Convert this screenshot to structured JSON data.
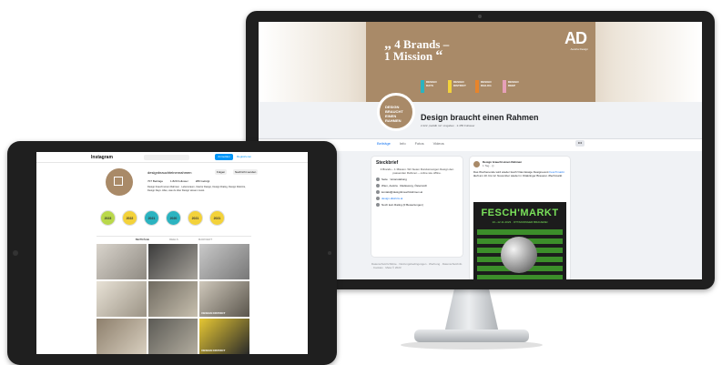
{
  "facebook": {
    "cover": {
      "quote_open": "„",
      "headline_line1": "4 Brands –",
      "headline_line2": "1 Mission",
      "quote_close": "“",
      "brand_logo": "AD",
      "brand_logo_sub": "Austria Design",
      "tiles": [
        {
          "label": "DESIGN\nDAYS",
          "color": "#2bb3c0"
        },
        {
          "label": "DESIGN\nDISTRICT",
          "color": "#f3d23a"
        },
        {
          "label": "DESIGN\nDIALOG",
          "color": "#e8842a"
        },
        {
          "label": "DESIGN\nDEEP",
          "color": "#e6a0b8"
        }
      ]
    },
    "profile_pic_text": "DESIGN\nBRAUCHT\nEINEN\nRAHMEN",
    "page_name": "Design braucht einen Rahmen",
    "page_meta": "2.222 „Gefällt mir“-Angaben · 2.455 Follower",
    "nav": [
      "Beiträge",
      "Info",
      "Fotos",
      "Videos"
    ],
    "nav_more": "•••",
    "intro": {
      "title": "Steckbrief",
      "text": "4 Brands – 1 Mission. Wir bieten Rundumsorgen Design den passenden Rahmen – online wie offline.",
      "rows": [
        {
          "icon": "info-icon",
          "text": "Seite · Veranstaltung"
        },
        {
          "icon": "location-icon",
          "text": "Wien, Austria · Radiowerg, Österreich"
        },
        {
          "icon": "mail-icon",
          "text": "kontakt@designbrauchtrahmen.at"
        },
        {
          "icon": "globe-icon",
          "text": "design-districts.at"
        },
        {
          "icon": "star-icon",
          "text": "Noch kein Rating (0 Bewertungen)"
        }
      ],
      "legal": "Datenschutzrichtlinie · Nutzungsbedingungen · Werbung · Datenschutzinfo · Cookies · Meta © 2023"
    },
    "post": {
      "author": "Design braucht einen Rahmen",
      "date": "1 Tag · ◎",
      "text": "Das Wochenende wird wieder fesch! Das lässige Designevent",
      "link_text": "Fesch'markt",
      "text_after": "läuft am 10. bis 12. November wieder in Ottakringer Brauerei. #fechmarkt",
      "image_title": "FESCH'MARKT",
      "image_date": "10.–12.11.2023 · OTTAKRINGER BRAUEREI"
    }
  },
  "instagram": {
    "logo": "Instagram",
    "login_label": "Anmelden",
    "signup_label": "Registrieren",
    "handle": "designbrauchteinenrahmen",
    "follow_label": "Folgen",
    "message_label": "Nachricht senden",
    "stats": [
      "707 Beiträge",
      "1.829 Follower",
      "289 Gefolgt"
    ],
    "bio": "Design braucht einen Rahmen · Lebensraum, Interior Design, Design Dialog, Design Districts, Design Days. Alles, was du über Design wissen musst.",
    "highlights": [
      {
        "label": "2023",
        "color": "#b9d84a"
      },
      {
        "label": "2022",
        "color": "#f3d23a"
      },
      {
        "label": "2021",
        "color": "#2bb3c0"
      },
      {
        "label": "2020",
        "color": "#2bb3c0"
      },
      {
        "label": "2021",
        "color": "#f3d23a"
      },
      {
        "label": "2021",
        "color": "#f3d23a"
      }
    ],
    "tabs": [
      "BEITRÄGE",
      "REELS",
      "MARKIERT"
    ],
    "grid_captions": [
      "",
      "",
      "",
      "",
      "",
      "DESIGN DISTRICT",
      "",
      "",
      "DESIGN DISTRICT"
    ]
  }
}
